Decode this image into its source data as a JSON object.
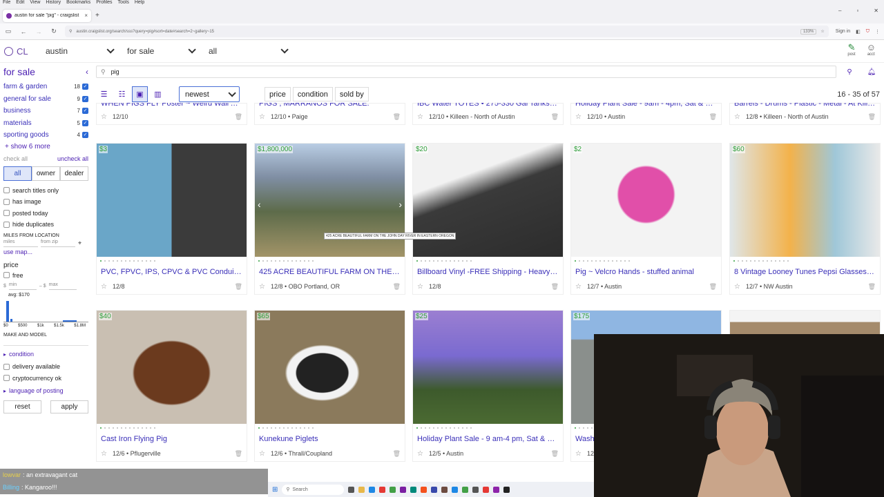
{
  "browser": {
    "menu": [
      "File",
      "Edit",
      "View",
      "History",
      "Bookmarks",
      "Profiles",
      "Tools",
      "Help"
    ],
    "tab_title": "austin for sale \"pig\" - craigslist",
    "url": "austin.craigslist.org/search/sss?query=pig#sort=date#search=2~gallery~15",
    "zoom": "133%",
    "sign_in": "Sign in"
  },
  "header": {
    "logo": "CL",
    "location": "austin",
    "category": "for sale",
    "subcategory": "all",
    "post": "post",
    "account": "acct"
  },
  "search": {
    "query": "pig"
  },
  "sidebar": {
    "title": "for sale",
    "categories": [
      {
        "label": "farm & garden",
        "count": "18"
      },
      {
        "label": "general for sale",
        "count": "9"
      },
      {
        "label": "business",
        "count": "7"
      },
      {
        "label": "materials",
        "count": "5"
      },
      {
        "label": "sporting goods",
        "count": "4"
      }
    ],
    "show_more": "+ show 6 more",
    "check_all": "check all",
    "uncheck_all": "uncheck all",
    "seller": [
      "all",
      "owner",
      "dealer"
    ],
    "options": [
      "search titles only",
      "has image",
      "posted today",
      "hide duplicates"
    ],
    "miles_label": "MILES FROM LOCATION",
    "miles_ph": "miles",
    "zip_ph": "from zip",
    "use_map": "use map...",
    "price_label": "price",
    "free": "free",
    "min_ph": "min",
    "max_ph": "max",
    "avg": "avg: $170",
    "hist_ticks": [
      "$0",
      "$500",
      "$1k",
      "$1.5k",
      "$1.8M"
    ],
    "make_model": "MAKE AND MODEL",
    "condition": "condition",
    "delivery": "delivery available",
    "crypto": "cryptocurrency ok",
    "language": "language of posting",
    "reset": "reset",
    "apply": "apply"
  },
  "toolbar": {
    "sort": "newest",
    "filters": [
      "price",
      "condition",
      "sold by"
    ],
    "count": "16 - 35 of 57"
  },
  "top_row": [
    {
      "title": "WHEN PIGS FLY Poster ~ Weird Wall Art...",
      "meta": "12/10"
    },
    {
      "title": "PIGS , MARRANOS FOR SALE.",
      "meta": "12/10 • Paige"
    },
    {
      "title": "IBC Water TOTES • 275-330 Gal Tanks • N...",
      "meta": "12/10 • Killeen - North of Austin"
    },
    {
      "title": "Holiday Plant Sale - 9am - 4pm, Sat & Su...",
      "meta": "12/10 • Austin"
    },
    {
      "title": "Barrels - Drums - Plastic - Metal - At Kille...",
      "meta": "12/8 • Killeen - North of Austin"
    }
  ],
  "row1": [
    {
      "price": "$3",
      "title": "PVC, FPVC, IPS, CPVC & PVC Conduit Pipe",
      "meta": "12/8"
    },
    {
      "price": "$1,800,000",
      "title": "425 ACRE BEAUTIFUL FARM ON THE JOH...",
      "meta": "12/8 • OBO Portland, OR",
      "tooltip": "425 ACRE BEAUTIFUL FARM ON THE JOHN DAY RIVER IN EASTERN OREGON"
    },
    {
      "price": "$20",
      "title": "Billboard Vinyl -FREE Shipping - Heavy D...",
      "meta": "12/8"
    },
    {
      "price": "$2",
      "title": "Pig ~ Velcro Hands - stuffed animal",
      "meta": "12/7 • Austin"
    },
    {
      "price": "$60",
      "title": "8 Vintage Looney Tunes Pepsi Glasses 1...",
      "meta": "12/7 • NW Austin"
    }
  ],
  "row2": [
    {
      "price": "$40",
      "title": "Cast Iron Flying Pig",
      "meta": "12/6 • Pflugerville"
    },
    {
      "price": "$65",
      "title": "Kunekune Piglets",
      "meta": "12/6 • Thrall/Coupland"
    },
    {
      "price": "$25",
      "title": "Holiday Plant Sale - 9 am-4 pm, Sat & Su...",
      "meta": "12/5 • Austin"
    },
    {
      "price": "$175",
      "title": "Washe",
      "meta": "12/"
    }
  ],
  "chat": [
    {
      "user": "lowvar",
      "msg": ": an extravagant cat"
    },
    {
      "user": "Billing",
      "msg": ": Kangaroo!!!"
    }
  ],
  "taskbar": {
    "search": "Search"
  }
}
